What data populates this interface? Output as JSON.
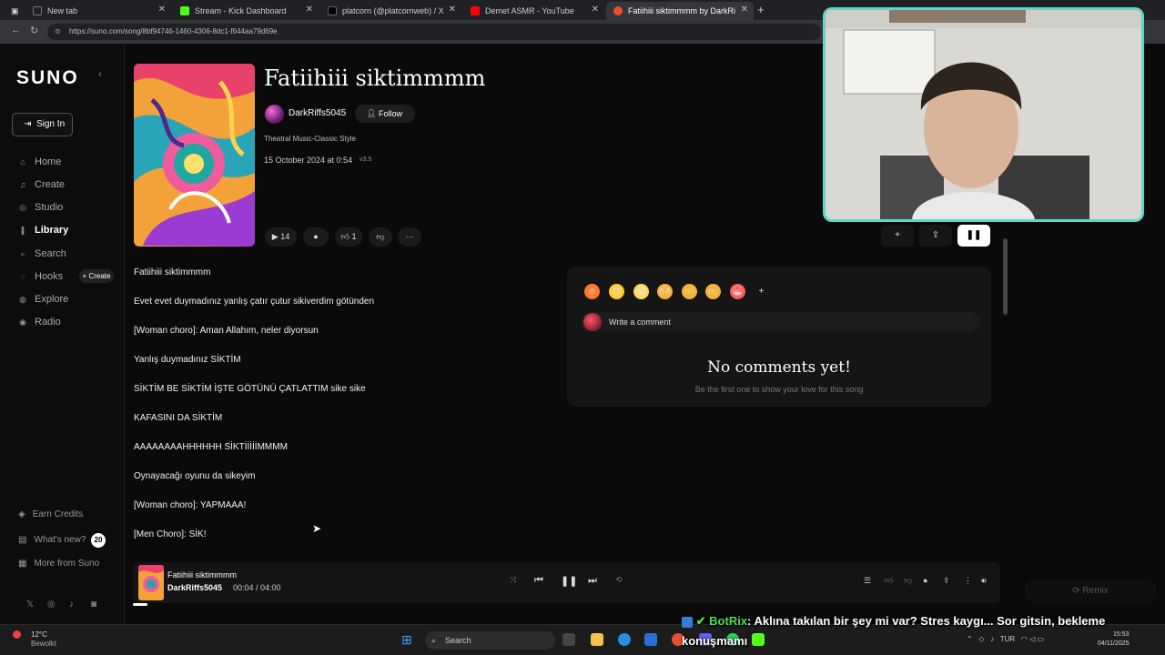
{
  "browser": {
    "tabs": [
      {
        "label": "New tab"
      },
      {
        "label": "Stream - Kick Dashboard"
      },
      {
        "label": "platcorn (@platcornweb) / X"
      },
      {
        "label": "Demet ASMR - YouTube"
      },
      {
        "label": "Fatiihiii siktimmmm by DarkRi"
      }
    ],
    "url": "https://suno.com/song/8bf94746-1460-4306-8dc1-f644aa79d69e"
  },
  "sidebar": {
    "logo": "SUNO",
    "signin_label": "Sign In",
    "nav": [
      {
        "label": "Home",
        "icon": "home-icon"
      },
      {
        "label": "Create",
        "icon": "music-note-icon"
      },
      {
        "label": "Studio",
        "icon": "studio-icon"
      },
      {
        "label": "Library",
        "icon": "library-icon"
      },
      {
        "label": "Search",
        "icon": "search-icon"
      },
      {
        "label": "Hooks",
        "icon": "hooks-icon"
      },
      {
        "label": "Explore",
        "icon": "compass-icon"
      },
      {
        "label": "Radio",
        "icon": "radio-icon"
      }
    ],
    "create_pill": "+ Create",
    "bottom": [
      {
        "label": "Earn Credits"
      },
      {
        "label": "What's new?"
      },
      {
        "label": "More from Suno"
      }
    ],
    "whats_new_count": "20"
  },
  "song": {
    "title": "Fatiihiii siktimmmm",
    "artist": "DarkRiffs5045",
    "follow_label": "Follow",
    "style": "Theatral Music-Classic Style",
    "date": "15 October 2024 at 0:54",
    "version": "v3.5",
    "play_count": "14",
    "like_count": "1"
  },
  "lyrics": [
    "Fatiihiii siktimmmm",
    "Evet evet duymadınız yanlış çatır çutur sikiverdim götünden",
    "[Woman choro]: Aman Allahım, neler diyorsun",
    "Yanlış duymadınız SİKTİM",
    "SİKTİM BE SİKTİM İŞTE GÖTÜNÜ ÇATLATTIM sike sike",
    "KAFASINI DA SİKTİM",
    "AAAAAAAAHHHHHH SİKTİİİİİMMMM",
    "Oynayacağı oyunu da sikeyim",
    "[Woman choro]:  YAPMAAA!",
    "[Men Choro]: SİK!"
  ],
  "comments": {
    "placeholder": "Write a comment",
    "empty_title": "No comments yet!",
    "empty_sub": "Be the first one to show your love for this song"
  },
  "player": {
    "title": "Fatiihiii siktimmmm",
    "artist": "DarkRiffs5045",
    "time": "00:04 / 04:00",
    "progress": 0.017,
    "remix_label": "Remix"
  },
  "taskbar": {
    "temp": "12°C",
    "weather": "Bewolkt",
    "search": "Search",
    "lang": "TUR",
    "time": "15:53",
    "date": "04/11/2025"
  },
  "overlay": {
    "bot": "BotRix",
    "message": ": Aklına takılan bir şey mi var? Stres kaygı... Sor gitsin, bekleme",
    "message2": "konuşmamı"
  },
  "colors": {
    "accent_webcam_border": "#5fd7c8",
    "bot_name": "#4be04b"
  }
}
